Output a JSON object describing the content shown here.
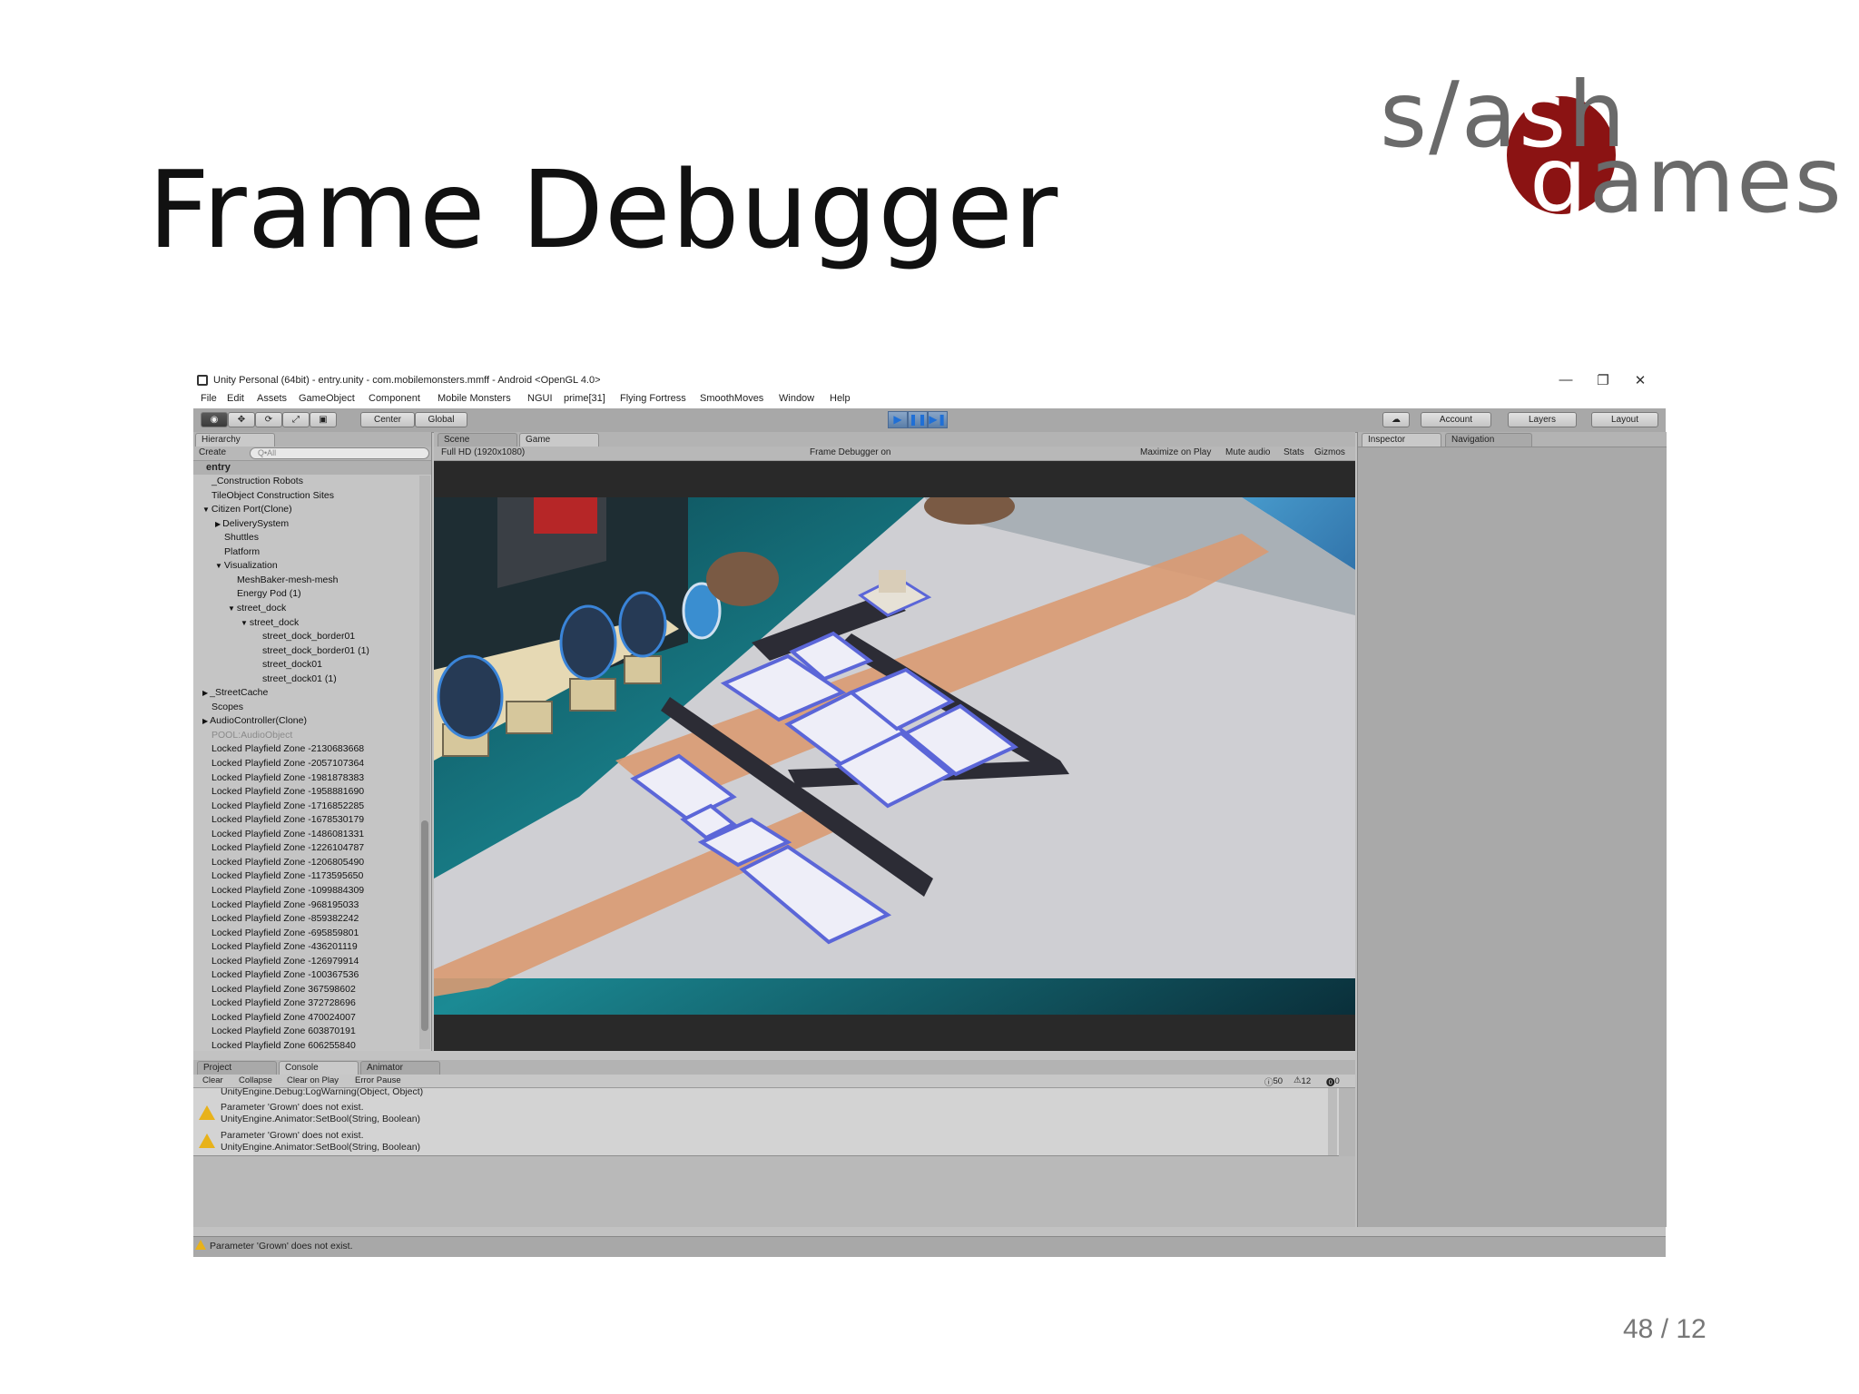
{
  "slide": {
    "title": "Frame Debugger",
    "logo": {
      "line1_a": "s/a",
      "line1_b": "s",
      "line1_c": "h",
      "line2_a": "g",
      "line2_b": "ames"
    },
    "page_number": "48 / 12"
  },
  "window": {
    "title": "Unity Personal (64bit) - entry.unity - com.mobilemonsters.mmff - Android <OpenGL 4.0>",
    "controls": {
      "minimize": "—",
      "restore": "❐",
      "close": "✕"
    }
  },
  "menu": [
    "File",
    "Edit",
    "Assets",
    "GameObject",
    "Component",
    "Mobile Monsters",
    "NGUI",
    "prime[31]",
    "Flying Fortress",
    "SmoothMoves",
    "Window",
    "Help"
  ],
  "toolbar": {
    "tools": [
      "◉",
      "✥",
      "⟳",
      "⤢",
      "▣"
    ],
    "pivot": "Center",
    "space": "Global",
    "play": "▶",
    "pause": "❚❚",
    "step": "▶❚",
    "cloud": "☁",
    "account": "Account",
    "layers": "Layers",
    "layout": "Layout"
  },
  "hierarchy": {
    "tab": "Hierarchy",
    "create": "Create",
    "search_placeholder": "Q•All",
    "scene": "entry",
    "items": [
      {
        "label": "_Construction Robots",
        "indent": 1,
        "arrow": ""
      },
      {
        "label": "TileObject Construction Sites",
        "indent": 1,
        "arrow": ""
      },
      {
        "label": "Citizen Port(Clone)",
        "indent": 1,
        "arrow": "▼"
      },
      {
        "label": "DeliverySystem",
        "indent": 2,
        "arrow": "▶"
      },
      {
        "label": "Shuttles",
        "indent": 2,
        "arrow": ""
      },
      {
        "label": "Platform",
        "indent": 2,
        "arrow": ""
      },
      {
        "label": "Visualization",
        "indent": 2,
        "arrow": "▼"
      },
      {
        "label": "MeshBaker-mesh-mesh",
        "indent": 3,
        "arrow": ""
      },
      {
        "label": "Energy Pod (1)",
        "indent": 3,
        "arrow": ""
      },
      {
        "label": "street_dock",
        "indent": 3,
        "arrow": "▼"
      },
      {
        "label": "street_dock",
        "indent": 4,
        "arrow": "▼"
      },
      {
        "label": "street_dock_border01",
        "indent": 5,
        "arrow": ""
      },
      {
        "label": "street_dock_border01 (1)",
        "indent": 5,
        "arrow": ""
      },
      {
        "label": "street_dock01",
        "indent": 5,
        "arrow": ""
      },
      {
        "label": "street_dock01 (1)",
        "indent": 5,
        "arrow": ""
      },
      {
        "label": "_StreetCache",
        "indent": 1,
        "arrow": "▶"
      },
      {
        "label": "Scopes",
        "indent": 1,
        "arrow": ""
      },
      {
        "label": "AudioController(Clone)",
        "indent": 1,
        "arrow": "▶"
      },
      {
        "label": "POOL:AudioObject",
        "indent": 1,
        "arrow": "",
        "dim": true
      },
      {
        "label": "Locked Playfield Zone -2130683668",
        "indent": 1,
        "arrow": ""
      },
      {
        "label": "Locked Playfield Zone -2057107364",
        "indent": 1,
        "arrow": ""
      },
      {
        "label": "Locked Playfield Zone -1981878383",
        "indent": 1,
        "arrow": ""
      },
      {
        "label": "Locked Playfield Zone -1958881690",
        "indent": 1,
        "arrow": ""
      },
      {
        "label": "Locked Playfield Zone -1716852285",
        "indent": 1,
        "arrow": ""
      },
      {
        "label": "Locked Playfield Zone -1678530179",
        "indent": 1,
        "arrow": ""
      },
      {
        "label": "Locked Playfield Zone -1486081331",
        "indent": 1,
        "arrow": ""
      },
      {
        "label": "Locked Playfield Zone -1226104787",
        "indent": 1,
        "arrow": ""
      },
      {
        "label": "Locked Playfield Zone -1206805490",
        "indent": 1,
        "arrow": ""
      },
      {
        "label": "Locked Playfield Zone -1173595650",
        "indent": 1,
        "arrow": ""
      },
      {
        "label": "Locked Playfield Zone -1099884309",
        "indent": 1,
        "arrow": ""
      },
      {
        "label": "Locked Playfield Zone -968195033",
        "indent": 1,
        "arrow": ""
      },
      {
        "label": "Locked Playfield Zone -859382242",
        "indent": 1,
        "arrow": ""
      },
      {
        "label": "Locked Playfield Zone -695859801",
        "indent": 1,
        "arrow": ""
      },
      {
        "label": "Locked Playfield Zone -436201119",
        "indent": 1,
        "arrow": ""
      },
      {
        "label": "Locked Playfield Zone -126979914",
        "indent": 1,
        "arrow": ""
      },
      {
        "label": "Locked Playfield Zone -100367536",
        "indent": 1,
        "arrow": ""
      },
      {
        "label": "Locked Playfield Zone 367598602",
        "indent": 1,
        "arrow": ""
      },
      {
        "label": "Locked Playfield Zone 372728696",
        "indent": 1,
        "arrow": ""
      },
      {
        "label": "Locked Playfield Zone 470024007",
        "indent": 1,
        "arrow": ""
      },
      {
        "label": "Locked Playfield Zone 603870191",
        "indent": 1,
        "arrow": ""
      },
      {
        "label": "Locked Playfield Zone 606255840",
        "indent": 1,
        "arrow": ""
      }
    ]
  },
  "view": {
    "tabs": [
      "Scene",
      "Game"
    ],
    "resolution": "Full HD (1920x1080)",
    "center_label": "Frame Debugger on",
    "buttons": [
      "Maximize on Play",
      "Mute audio",
      "Stats",
      "Gizmos"
    ]
  },
  "inspector": {
    "tabs": [
      "Inspector",
      "Navigation"
    ]
  },
  "console": {
    "tabs": [
      "Project",
      "Console",
      "Animator"
    ],
    "buttons": [
      "Clear",
      "Collapse",
      "Clear on Play",
      "Error Pause"
    ],
    "counts": {
      "info": "50",
      "warnings": "12",
      "errors": "0"
    },
    "entries": [
      {
        "line1": "UnityEngine.Debug:LogWarning(Object, Object)",
        "line2": ""
      },
      {
        "line1": "Parameter 'Grown' does not exist.",
        "line2": "UnityEngine.Animator:SetBool(String, Boolean)"
      },
      {
        "line1": "Parameter 'Grown' does not exist.",
        "line2": "UnityEngine.Animator:SetBool(String, Boolean)"
      }
    ]
  },
  "status": {
    "message": "Parameter 'Grown' does not exist."
  },
  "colors": {
    "play_blue": "#1f6fd6",
    "warning": "#e8b21a",
    "logo_red": "#8b1313"
  }
}
